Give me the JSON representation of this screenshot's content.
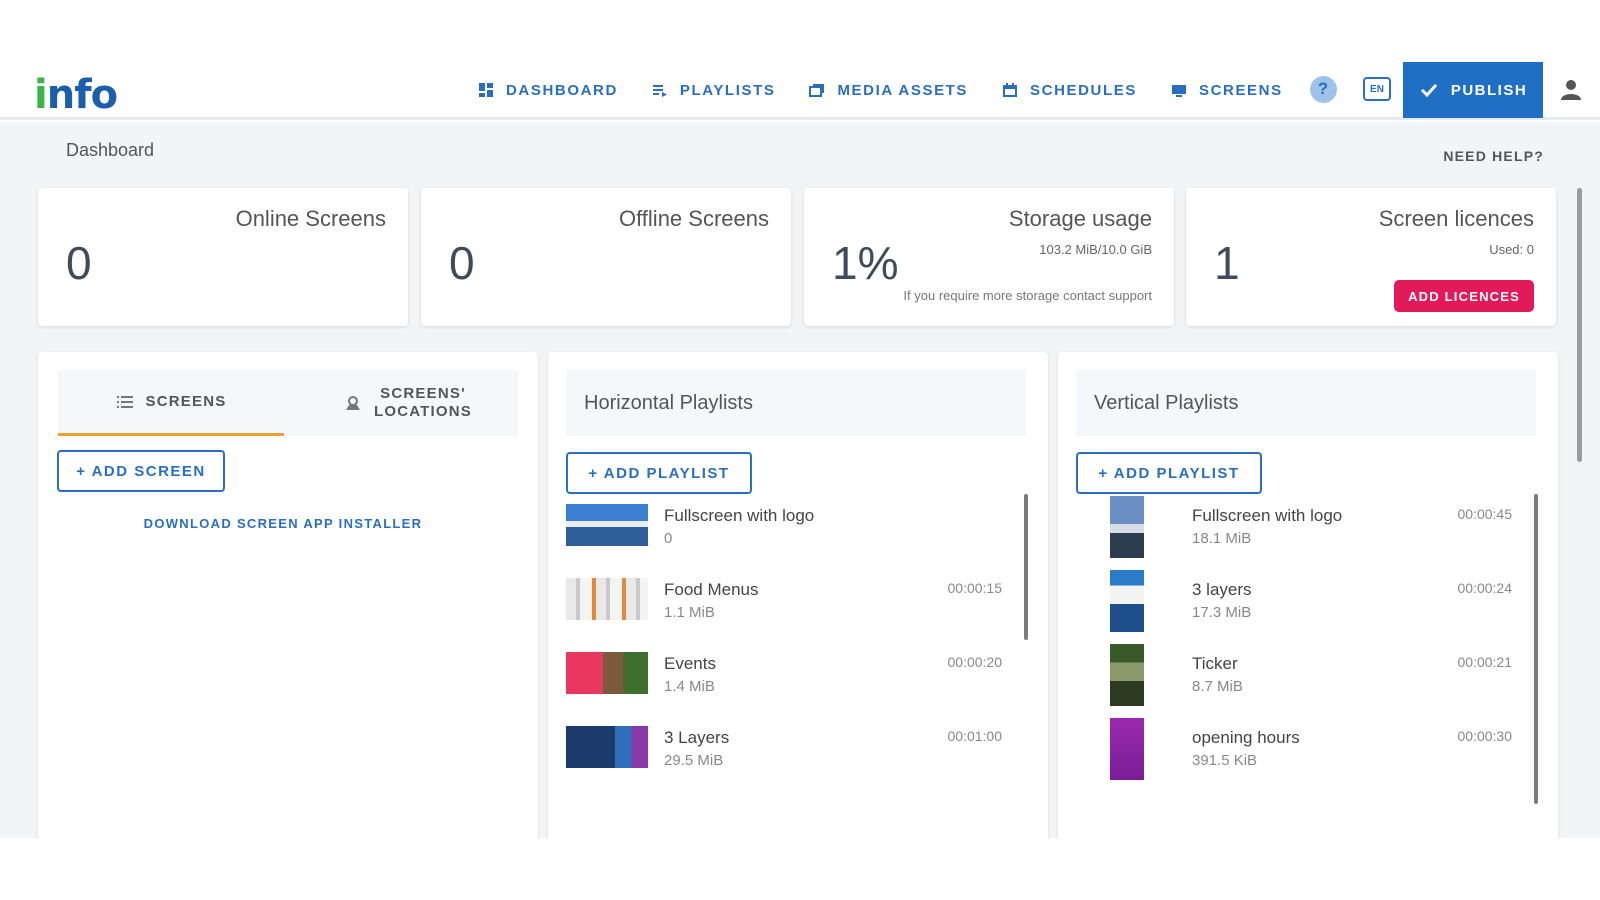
{
  "app": {
    "logo": "nfo",
    "logo_dot": "i"
  },
  "nav": {
    "items": [
      {
        "label": "DASHBOARD",
        "icon": "dashboard-icon"
      },
      {
        "label": "PLAYLISTS",
        "icon": "playlist-icon"
      },
      {
        "label": "MEDIA ASSETS",
        "icon": "media-icon"
      },
      {
        "label": "SCHEDULES",
        "icon": "calendar-icon"
      },
      {
        "label": "SCREENS",
        "icon": "monitor-icon"
      }
    ],
    "help_icon": "?",
    "lang_label": "EN",
    "publish_label": "PUBLISH"
  },
  "header": {
    "breadcrumb": "Dashboard",
    "need_help": "NEED HELP?"
  },
  "stats": {
    "online": {
      "title": "Online Screens",
      "value": "0"
    },
    "offline": {
      "title": "Offline Screens",
      "value": "0"
    },
    "storage": {
      "title": "Storage usage",
      "value": "1%",
      "sub": "103.2 MiB/10.0 GiB",
      "note": "If you require more storage contact support"
    },
    "licences": {
      "title": "Screen licences",
      "value": "1",
      "sub": "Used: 0",
      "button": "ADD LICENCES"
    }
  },
  "screens_panel": {
    "tab_screens": "SCREENS",
    "tab_locations_line1": "SCREENS'",
    "tab_locations_line2": "LOCATIONS",
    "add_screen": "+ ADD SCREEN",
    "download": "DOWNLOAD SCREEN APP INSTALLER"
  },
  "horizontal": {
    "title": "Horizontal Playlists",
    "add": "+ ADD PLAYLIST",
    "items": [
      {
        "name": "Fullscreen with logo",
        "size": "0",
        "duration": ""
      },
      {
        "name": "Food Menus",
        "size": "1.1 MiB",
        "duration": "00:00:15"
      },
      {
        "name": "Events",
        "size": "1.4 MiB",
        "duration": "00:00:20"
      },
      {
        "name": "3 Layers",
        "size": "29.5 MiB",
        "duration": "00:01:00"
      }
    ]
  },
  "vertical": {
    "title": "Vertical Playlists",
    "add": "+ ADD PLAYLIST",
    "items": [
      {
        "name": "Fullscreen with logo",
        "size": "18.1 MiB",
        "duration": "00:00:45"
      },
      {
        "name": "3 layers",
        "size": "17.3 MiB",
        "duration": "00:00:24"
      },
      {
        "name": "Ticker",
        "size": "8.7 MiB",
        "duration": "00:00:21"
      },
      {
        "name": "opening hours",
        "size": "391.5 KiB",
        "duration": "00:00:30"
      }
    ]
  },
  "colors": {
    "brand": "#1f6fc4",
    "accent_pink": "#e21a5b",
    "tab_underline": "#f0a030",
    "logo_green": "#3bb54a"
  }
}
